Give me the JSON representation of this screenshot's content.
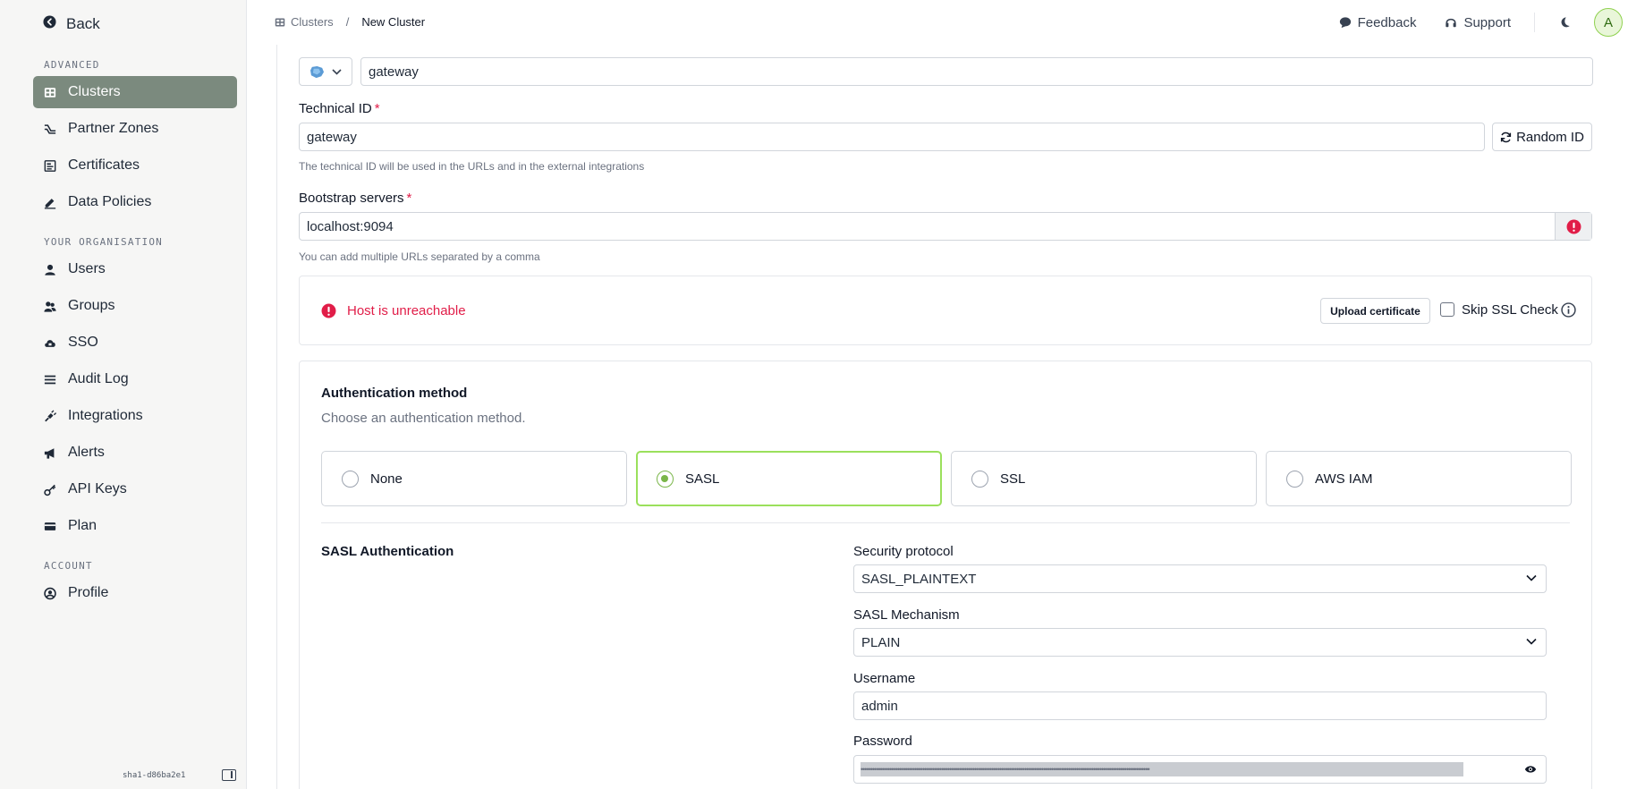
{
  "sidebar": {
    "back_label": "Back",
    "sections": {
      "advanced": "ADVANCED",
      "organisation": "YOUR ORGANISATION",
      "account": "ACCOUNT"
    },
    "items": {
      "clusters": "Clusters",
      "partner_zones": "Partner Zones",
      "certificates": "Certificates",
      "data_policies": "Data Policies",
      "users": "Users",
      "groups": "Groups",
      "sso": "SSO",
      "audit_log": "Audit Log",
      "integrations": "Integrations",
      "alerts": "Alerts",
      "api_keys": "API Keys",
      "plan": "Plan",
      "profile": "Profile"
    },
    "sha": "sha1-d86ba2e1"
  },
  "header": {
    "breadcrumb_parent": "Clusters",
    "breadcrumb_separator": "/",
    "breadcrumb_current": "New Cluster",
    "feedback": "Feedback",
    "support": "Support",
    "avatar_initial": "A"
  },
  "form": {
    "name_value": "gateway",
    "technical_id_label": "Technical ID",
    "required_mark": "*",
    "technical_id_value": "gateway",
    "random_id_button": "Random ID",
    "technical_id_help": "The technical ID will be used in the URLs and in the external integrations",
    "bootstrap_label": "Bootstrap servers",
    "bootstrap_value": "localhost:9094",
    "bootstrap_help": "You can add multiple URLs separated by a comma",
    "error_text": "Host is unreachable",
    "upload_certificate": "Upload certificate",
    "skip_ssl_label": "Skip SSL Check"
  },
  "auth": {
    "title": "Authentication method",
    "subtitle": "Choose an authentication method.",
    "options": [
      "None",
      "SASL",
      "SSL",
      "AWS IAM"
    ],
    "selected": "SASL",
    "sasl_section_title": "SASL Authentication",
    "security_protocol_label": "Security protocol",
    "security_protocol_value": "SASL_PLAINTEXT",
    "mechanism_label": "SASL Mechanism",
    "mechanism_value": "PLAIN",
    "username_label": "Username",
    "username_value": "admin",
    "password_label": "Password",
    "password_mask": "••••••••••••••••••••••••••••••••••••••••••••••••••••••••••••••••••••••••••••••••••••••••••••••••••••••••••••••••••••••••••••••••••••••••••••••••••••••"
  },
  "colors": {
    "accent_green": "#7ab649",
    "sidebar_active": "#7b8a7e",
    "error_red": "#e11d48"
  }
}
